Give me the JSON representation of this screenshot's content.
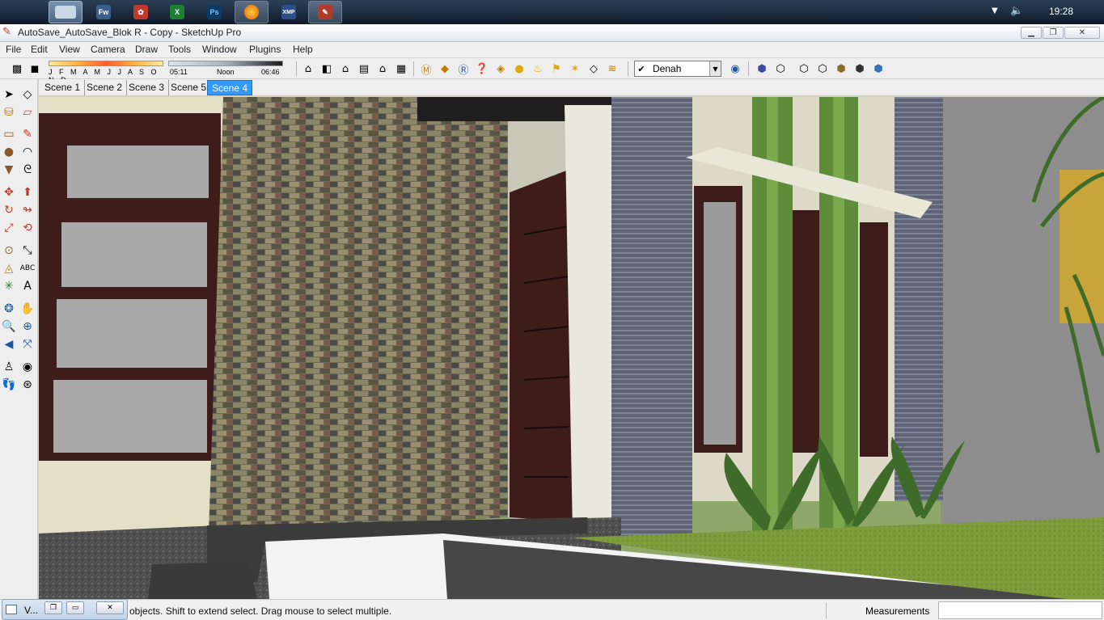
{
  "taskbar": {
    "clock": "19:28",
    "apps": [
      {
        "name": "start-icon",
        "glyph": "",
        "color": "#000000"
      },
      {
        "name": "desktop-icon",
        "glyph": "",
        "color": "#3b6ea5"
      },
      {
        "name": "fireworks-icon",
        "glyph": "Fw",
        "color": "#2b5a86"
      },
      {
        "name": "acrobat-icon",
        "glyph": "",
        "color": "#c0392b"
      },
      {
        "name": "excel-icon",
        "glyph": "",
        "color": "#1e7e34"
      },
      {
        "name": "photoshop-icon",
        "glyph": "Ps",
        "color": "#0d3b66"
      },
      {
        "name": "firefox-icon",
        "glyph": "",
        "color": "#e66000"
      },
      {
        "name": "xampp-icon",
        "glyph": "XMP",
        "color": "#2b4f8a"
      },
      {
        "name": "sketchup-icon",
        "glyph": "",
        "color": "#b03a2e"
      }
    ]
  },
  "window": {
    "title": "AutoSave_AutoSave_Blok R - Copy - SketchUp Pro"
  },
  "menu": [
    "File",
    "Edit",
    "View",
    "Camera",
    "Draw",
    "Tools",
    "Window",
    "Plugins",
    "Help"
  ],
  "shadows": {
    "months": "J F M A M J J A S O N D",
    "time_start": "05:11",
    "time_mid": "Noon",
    "time_end": "06:46"
  },
  "layer": {
    "current": "Denah"
  },
  "scenes": [
    {
      "label": "Scene 1",
      "selected": false
    },
    {
      "label": "Scene 2",
      "selected": false
    },
    {
      "label": "Scene 3",
      "selected": false
    },
    {
      "label": "Scene 5",
      "selected": false
    },
    {
      "label": "Scene 4",
      "selected": true
    }
  ],
  "status": {
    "hint": "objects. Shift to extend select. Drag mouse to select multiple.",
    "measurements_label": "Measurements",
    "measurements_value": ""
  },
  "mini_window": {
    "title": "V..."
  },
  "colors": {
    "accent": "#3399ff",
    "stone": "#6f6a55",
    "siding": "#5e6474",
    "trim": "#3e1c1a",
    "grass": "#7e9c3c",
    "green_column": "#5e8c3a"
  }
}
